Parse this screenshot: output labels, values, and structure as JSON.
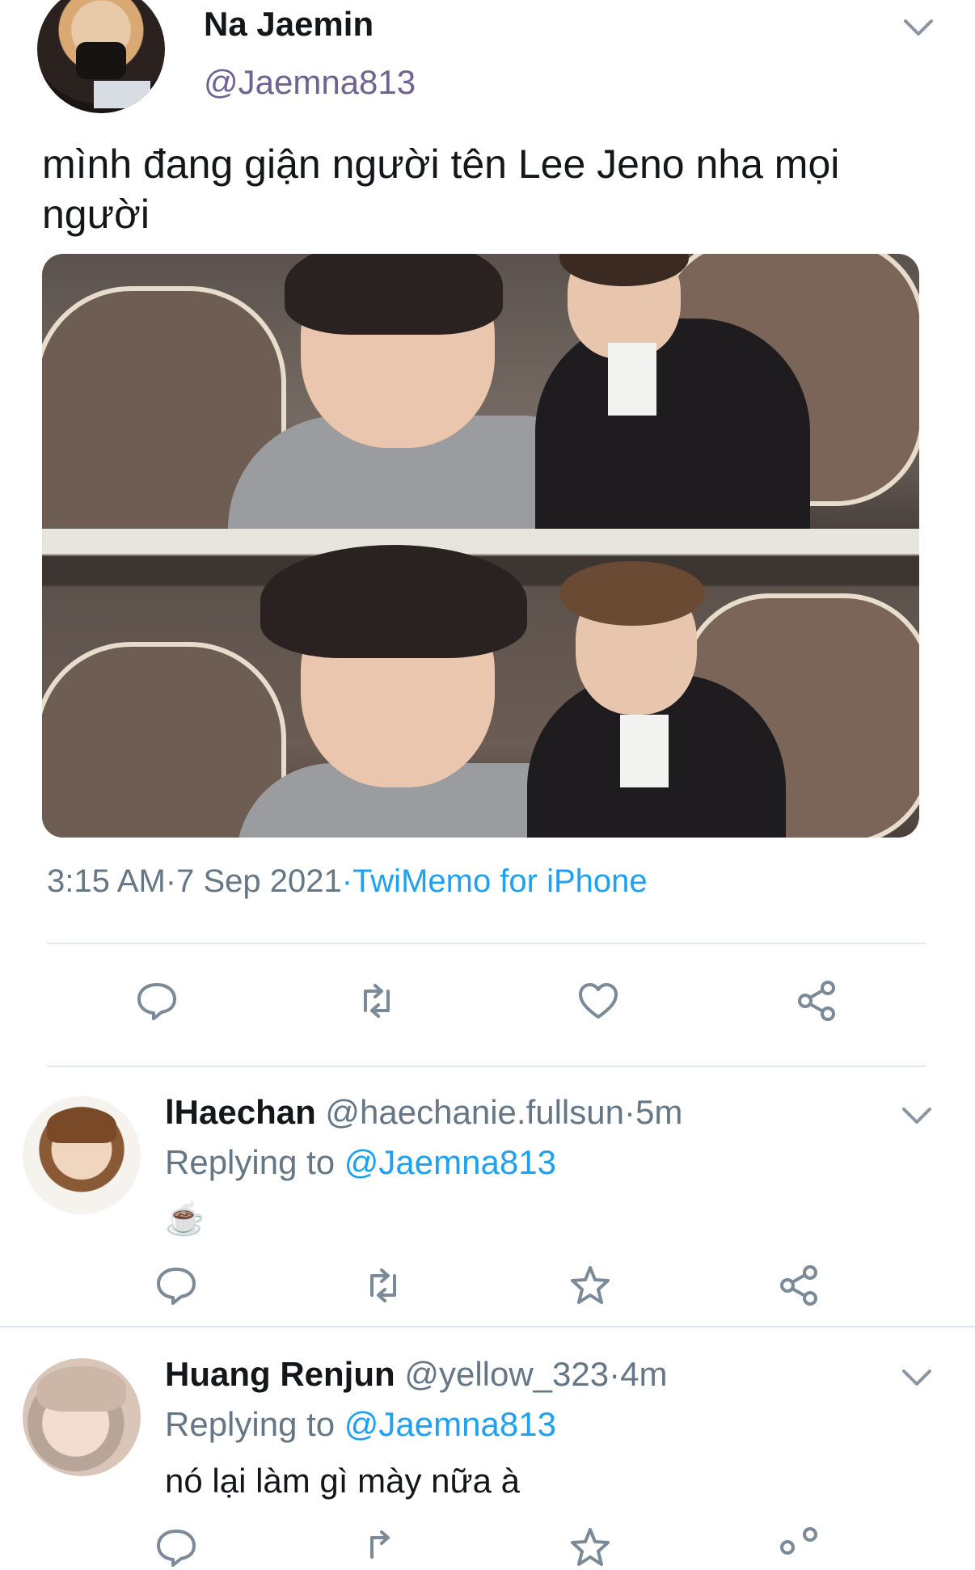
{
  "tweet": {
    "author_name": "Na Jaemin",
    "author_handle": "@Jaemna813",
    "text": "mình đang giận người tên Lee Jeno nha mọi người",
    "time": "3:15 AM",
    "date": "7 Sep 2021",
    "source": "TwiMemo for iPhone",
    "separator": "·"
  },
  "replies": [
    {
      "name": "lHaechan",
      "handle": "@haechanie.fullsun",
      "age": "5m",
      "replying_prefix": "Replying to",
      "replying_handle": "@Jaemna813",
      "text": "☕"
    },
    {
      "name": "Huang Renjun",
      "handle": "@yellow_323",
      "age": "4m",
      "replying_prefix": "Replying to",
      "replying_handle": "@Jaemna813",
      "text": "nó lại làm gì mày nữa à"
    }
  ],
  "icons": {
    "reply": "reply-icon",
    "retweet": "retweet-icon",
    "like": "heart-icon",
    "favorite": "star-icon",
    "share": "share-icon",
    "more": "chevron-down-icon"
  },
  "colors": {
    "link": "#1da1f2",
    "muted": "#657786",
    "icon": "#7b8a98",
    "divider": "#e1e8ed"
  }
}
